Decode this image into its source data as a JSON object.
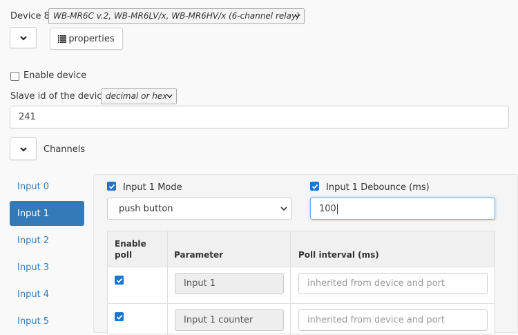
{
  "device": {
    "label": "Device 8",
    "type_selected": "WB-MR6C v.2, WB-MR6LV/x, WB-MR6HV/x (6-channel relay)",
    "properties_label": "properties"
  },
  "enable_device": {
    "label": "Enable device",
    "checked": false
  },
  "slave_id": {
    "label": "Slave id of the device",
    "format_selected": "decimal or hex",
    "value": "241"
  },
  "channels": {
    "label": "Channels"
  },
  "tabs": [
    {
      "label": "Input 0"
    },
    {
      "label": "Input 1"
    },
    {
      "label": "Input 2"
    },
    {
      "label": "Input 3"
    },
    {
      "label": "Input 4"
    },
    {
      "label": "Input 5"
    }
  ],
  "input_panel": {
    "mode_label": "Input 1 Mode",
    "mode_checked": true,
    "mode_selected": "push button",
    "debounce_label": "Input 1 Debounce (ms)",
    "debounce_checked": true,
    "debounce_value": "100"
  },
  "poll_table": {
    "headers": {
      "enable": "Enable poll",
      "parameter": "Parameter",
      "interval": "Poll interval (ms)"
    },
    "rows": [
      {
        "enabled": true,
        "parameter": "Input 1",
        "interval_placeholder": "inherited from device and port"
      },
      {
        "enabled": true,
        "parameter": "Input 1 counter",
        "interval_placeholder": "inherited from device and port"
      }
    ]
  },
  "colors": {
    "accent": "#337ab7",
    "checkbox": "#1976d2",
    "background": "#f9f9f9"
  }
}
